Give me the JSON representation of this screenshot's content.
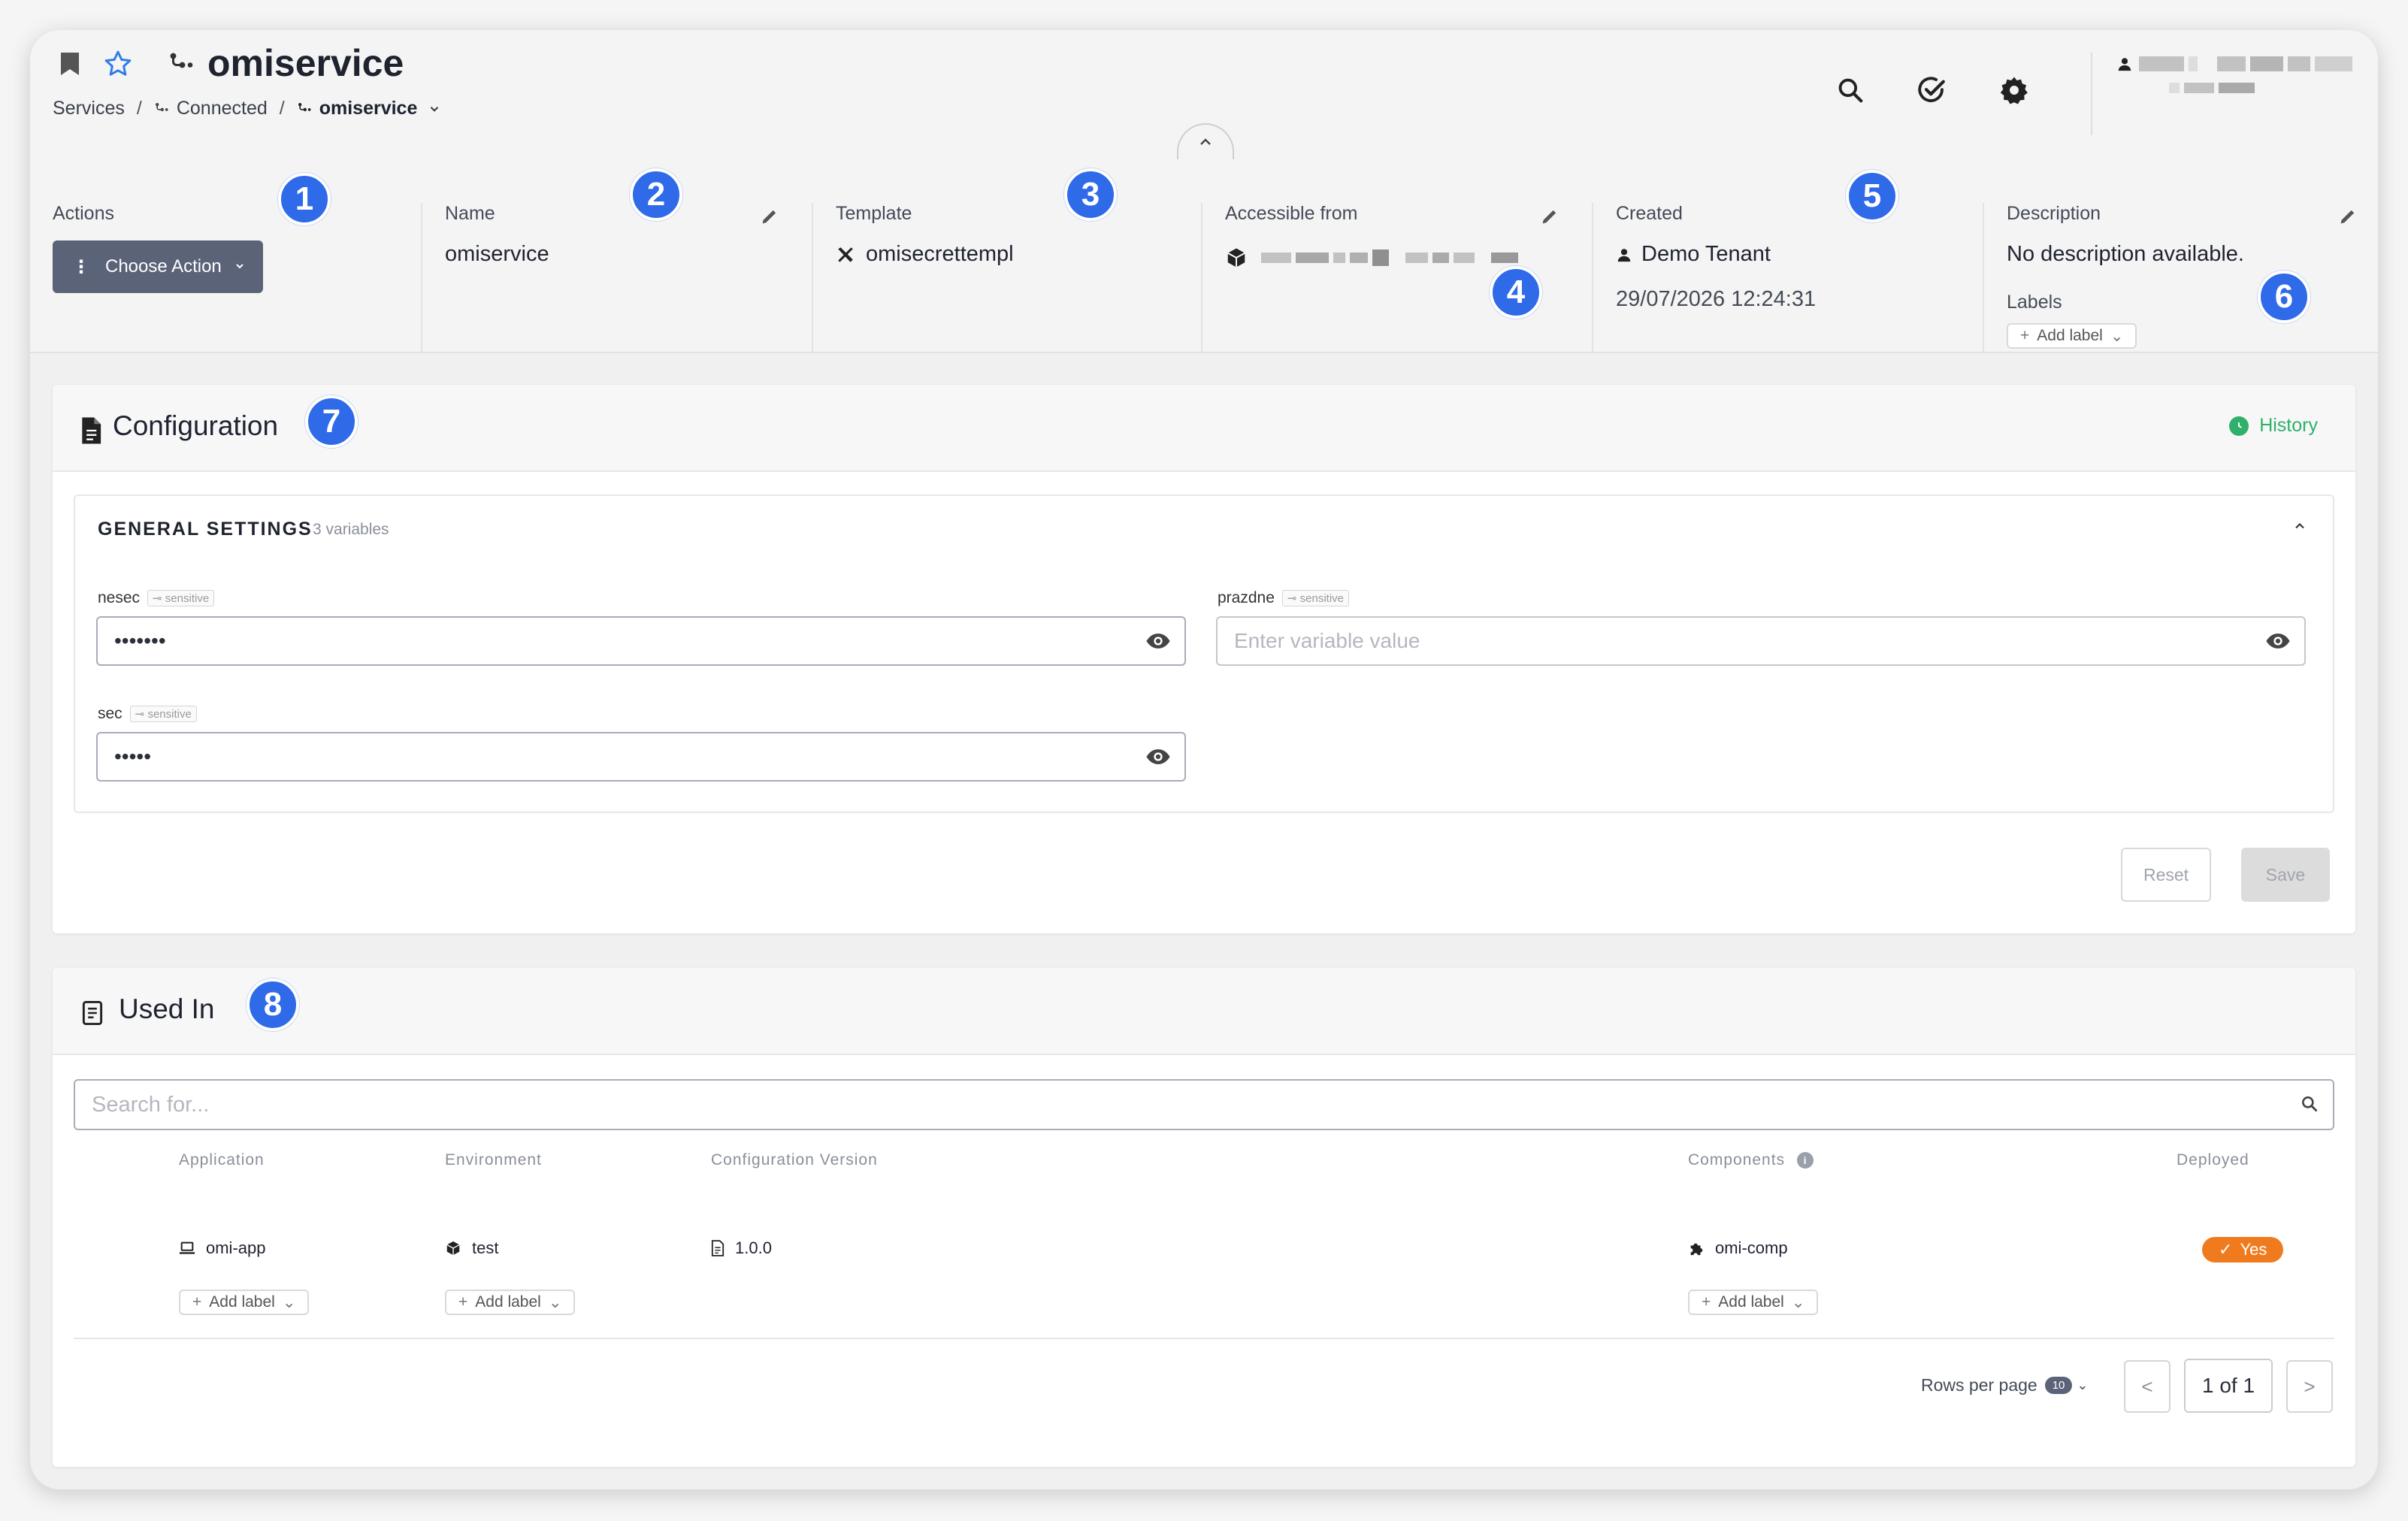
{
  "header": {
    "title": "omiservice",
    "breadcrumb": {
      "root": "Services",
      "mid": "Connected",
      "current": "omiservice"
    }
  },
  "info": {
    "actions": {
      "label": "Actions",
      "button": "Choose Action"
    },
    "name": {
      "label": "Name",
      "value": "omiservice"
    },
    "template": {
      "label": "Template",
      "value": "omisecrettempl"
    },
    "accessible": {
      "label": "Accessible from"
    },
    "created": {
      "label": "Created",
      "tenant": "Demo Tenant",
      "date": "29/07/2026 12:24:31"
    },
    "description": {
      "label": "Description",
      "value": "No description available.",
      "labels_label": "Labels",
      "add_label": "Add label"
    }
  },
  "badges": [
    "1",
    "2",
    "3",
    "4",
    "5",
    "6",
    "7",
    "8"
  ],
  "configuration": {
    "title": "Configuration",
    "history": "History",
    "section_title": "GENERAL SETTINGS",
    "section_count": "3 variables",
    "sensitive_tag": "sensitive",
    "fields": [
      {
        "label": "nesec",
        "value": "•••••••",
        "placeholder": ""
      },
      {
        "label": "prazdne",
        "value": "",
        "placeholder": "Enter variable value"
      },
      {
        "label": "sec",
        "value": "•••••",
        "placeholder": ""
      }
    ],
    "reset": "Reset",
    "save": "Save"
  },
  "used_in": {
    "title": "Used In",
    "search_placeholder": "Search for...",
    "columns": [
      "Application",
      "Environment",
      "Configuration Version",
      "Components",
      "Deployed"
    ],
    "rows": [
      {
        "application": "omi-app",
        "environment": "test",
        "version": "1.0.0",
        "components": "omi-comp",
        "deployed": "Yes"
      }
    ],
    "add_label": "Add label",
    "rows_per_page_label": "Rows per page",
    "rows_per_page": "10",
    "page": "1 of 1",
    "prev": "<",
    "next": ">"
  },
  "colors": {
    "accent": "#2f6ae8",
    "button": "#5b6378",
    "history": "#2fb06b",
    "deployed": "#f07b1e"
  }
}
